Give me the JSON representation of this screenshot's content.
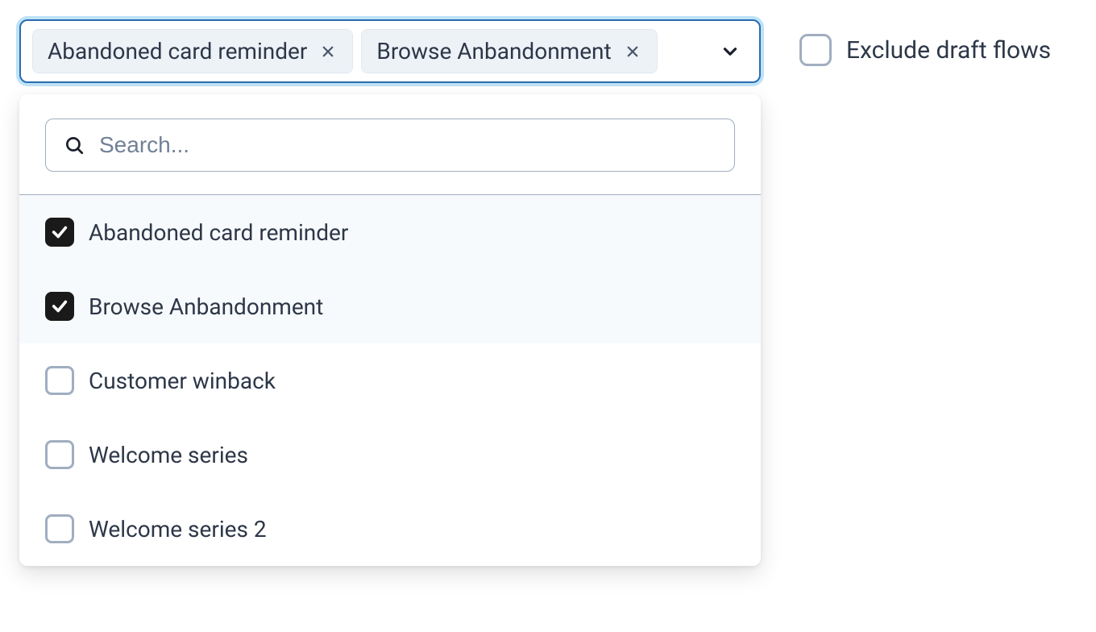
{
  "multiselect": {
    "chips": [
      {
        "label": "Abandoned card reminder"
      },
      {
        "label": "Browse Anbandonment"
      }
    ],
    "search_placeholder": "Search...",
    "options": [
      {
        "label": "Abandoned card reminder",
        "selected": true
      },
      {
        "label": "Browse Anbandonment",
        "selected": true
      },
      {
        "label": "Customer winback",
        "selected": false
      },
      {
        "label": "Welcome series",
        "selected": false
      },
      {
        "label": "Welcome series 2",
        "selected": false
      }
    ]
  },
  "exclude": {
    "label": "Exclude draft flows",
    "checked": false
  }
}
